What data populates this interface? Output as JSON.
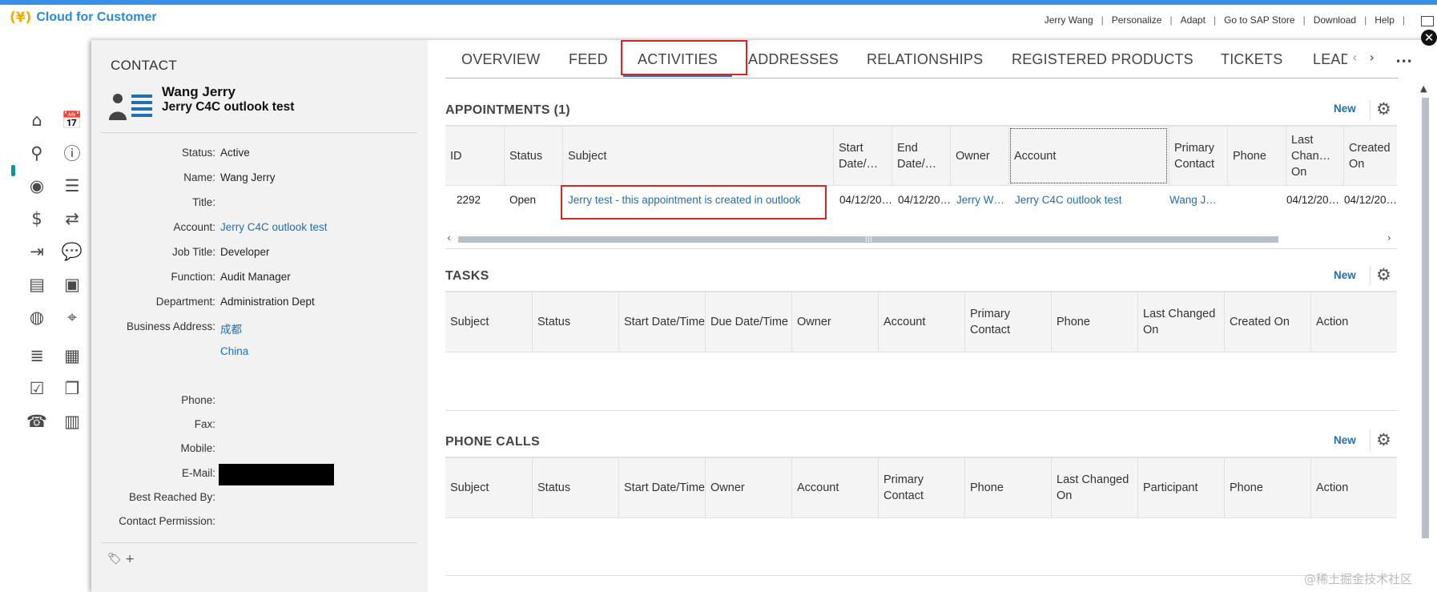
{
  "header": {
    "logo_mark": "(¥)",
    "app_title": "Cloud for Customer",
    "nav": [
      "Jerry Wang",
      "Personalize",
      "Adapt",
      "Go to SAP Store",
      "Download",
      "Help"
    ]
  },
  "leftnav_icons": [
    "home-icon",
    "calendar-icon",
    "search-icon",
    "alert-icon",
    "person-icon",
    "contact-list-icon",
    "dollar-icon",
    "transfer-icon",
    "forecast-icon",
    "chat-money-icon",
    "notebook-icon",
    "dollar-doc-icon",
    "globe-icon",
    "map-icon",
    "list-icon",
    "calendar2-icon",
    "checklist-icon",
    "docs-icon",
    "phone-icon",
    "clipboard-icon"
  ],
  "contact": {
    "section_label": "CONTACT",
    "name": "Wang Jerry",
    "account_name": "Jerry C4C outlook test",
    "fields": [
      {
        "label": "Status:",
        "value": "Active",
        "link": false
      },
      {
        "label": "Name:",
        "value": "Wang Jerry",
        "link": false
      },
      {
        "label": "Title:",
        "value": "",
        "link": false
      },
      {
        "label": "Account:",
        "value": "Jerry C4C outlook test",
        "link": true
      },
      {
        "label": "Job Title:",
        "value": "Developer",
        "link": false
      },
      {
        "label": "Function:",
        "value": "Audit Manager",
        "link": false
      },
      {
        "label": "Department:",
        "value": "Administration Dept",
        "link": false
      },
      {
        "label": "Business Address:",
        "value": "成都",
        "link": true
      }
    ],
    "address_line2": "China",
    "fields2": [
      {
        "label": "Phone:",
        "value": ""
      },
      {
        "label": "Fax:",
        "value": ""
      },
      {
        "label": "Mobile:",
        "value": ""
      },
      {
        "label": "E-Mail:",
        "value": ""
      },
      {
        "label": "Best Reached By:",
        "value": ""
      },
      {
        "label": "Contact Permission:",
        "value": ""
      }
    ],
    "tag_add": "+"
  },
  "tabs": [
    "OVERVIEW",
    "FEED",
    "ACTIVITIES",
    "ADDRESSES",
    "RELATIONSHIPS",
    "REGISTERED PRODUCTS",
    "TICKETS",
    "LEADS"
  ],
  "active_tab": "ACTIVITIES",
  "appointments": {
    "title": "APPOINTMENTS (1)",
    "new_label": "New",
    "columns": [
      "ID",
      "Status",
      "Subject",
      "Start Date/…",
      "End Date/…",
      "Owner",
      "Account",
      "Primary Contact",
      "Phone",
      "Last Chan… On",
      "Created On"
    ],
    "row": {
      "id": "2292",
      "status": "Open",
      "subject": "Jerry test - this appointment is created in outlook",
      "start": "04/12/20…",
      "end": "04/12/20…",
      "owner": "Jerry W…",
      "account": "Jerry C4C outlook test",
      "primary_contact": "Wang J…",
      "phone": "",
      "last_changed": "04/12/20…",
      "created": "04/12/20…"
    }
  },
  "tasks": {
    "title": "TASKS",
    "new_label": "New",
    "columns": [
      "Subject",
      "Status",
      "Start Date/Time",
      "Due Date/Time",
      "Owner",
      "Account",
      "Primary Contact",
      "Phone",
      "Last Changed On",
      "Created On",
      "Action"
    ]
  },
  "phone_calls": {
    "title": "PHONE CALLS",
    "new_label": "New",
    "columns": [
      "Subject",
      "Status",
      "Start Date/Time",
      "Owner",
      "Account",
      "Primary Contact",
      "Phone",
      "Last Changed On",
      "Participant",
      "Phone",
      "Action"
    ]
  },
  "watermark": "@稀土掘金技术社区",
  "colors": {
    "accent": "#2d6fba",
    "link": "#1f6fb2",
    "highlight": "#dd2222",
    "logo": "#f0ab00"
  }
}
